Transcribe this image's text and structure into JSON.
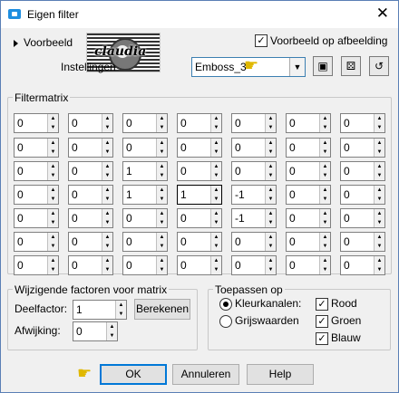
{
  "window": {
    "title": "Eigen filter"
  },
  "preview": {
    "toggle_label": "Voorbeeld",
    "checkbox_label": "Voorbeeld op afbeelding",
    "checked": true,
    "logo_text": "claudia"
  },
  "settings": {
    "label": "Instellingen",
    "preset_value": "Emboss_3"
  },
  "toolbar": {
    "save_icon": "save-icon",
    "random_icon": "dice-icon",
    "reset_icon": "reset-icon"
  },
  "matrix": {
    "label": "Filtermatrix",
    "rows": [
      [
        "0",
        "0",
        "0",
        "0",
        "0",
        "0",
        "0"
      ],
      [
        "0",
        "0",
        "0",
        "0",
        "0",
        "0",
        "0"
      ],
      [
        "0",
        "0",
        "1",
        "0",
        "0",
        "0",
        "0"
      ],
      [
        "0",
        "0",
        "1",
        "1",
        "-1",
        "0",
        "0"
      ],
      [
        "0",
        "0",
        "0",
        "0",
        "-1",
        "0",
        "0"
      ],
      [
        "0",
        "0",
        "0",
        "0",
        "0",
        "0",
        "0"
      ],
      [
        "0",
        "0",
        "0",
        "0",
        "0",
        "0",
        "0"
      ]
    ]
  },
  "factors": {
    "label": "Wijzigende factoren voor matrix",
    "divisor_label": "Deelfactor:",
    "divisor_value": "1",
    "calc_button": "Berekenen",
    "bias_label": "Afwijking:",
    "bias_value": "0"
  },
  "apply": {
    "label": "Toepassen op",
    "color_channels": "Kleurkanalen:",
    "grayscale": "Grijswaarden",
    "red": "Rood",
    "green": "Groen",
    "blue": "Blauw"
  },
  "buttons": {
    "ok": "OK",
    "cancel": "Annuleren",
    "help": "Help"
  }
}
